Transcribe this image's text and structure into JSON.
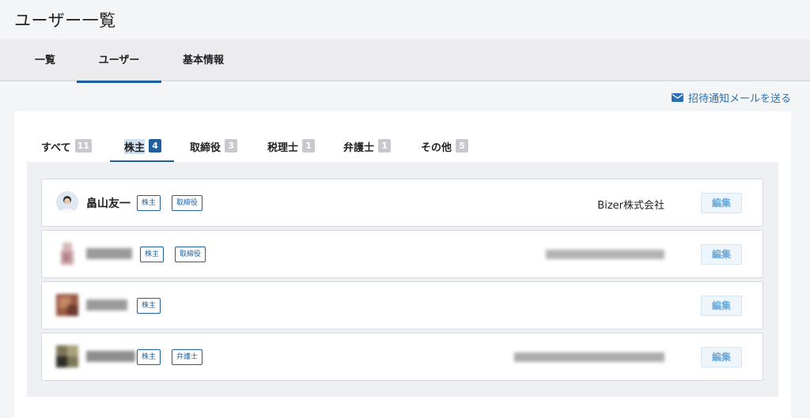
{
  "page": {
    "title": "ユーザー一覧"
  },
  "top_tabs": [
    {
      "label": "一覧",
      "active": false
    },
    {
      "label": "ユーザー",
      "active": true
    },
    {
      "label": "基本情報",
      "active": false
    }
  ],
  "invite": {
    "label": "招待通知メールを送る",
    "icon": "mail-icon"
  },
  "sub_tabs": [
    {
      "label": "すべて",
      "count": "11",
      "active": false
    },
    {
      "label": "株主",
      "count": "4",
      "active": true
    },
    {
      "label": "取締役",
      "count": "3",
      "active": false
    },
    {
      "label": "税理士",
      "count": "1",
      "active": false
    },
    {
      "label": "弁護士",
      "count": "1",
      "active": false
    },
    {
      "label": "その他",
      "count": "5",
      "active": false
    }
  ],
  "users": [
    {
      "name": "畠山友一",
      "roles": [
        "株主",
        "取締役"
      ],
      "company": "Bizer株式会社",
      "edit_label": "編集"
    },
    {
      "name": "",
      "roles": [
        "株主",
        "取締役"
      ],
      "company": "",
      "edit_label": "編集"
    },
    {
      "name": "",
      "roles": [
        "株主"
      ],
      "company": "",
      "edit_label": "編集"
    },
    {
      "name": "",
      "roles": [
        "株主",
        "弁護士"
      ],
      "company": "",
      "edit_label": "編集"
    }
  ],
  "colors": {
    "accent": "#1f5f9e",
    "link": "#2a6fb0",
    "edit_text": "#6aa9d8"
  }
}
